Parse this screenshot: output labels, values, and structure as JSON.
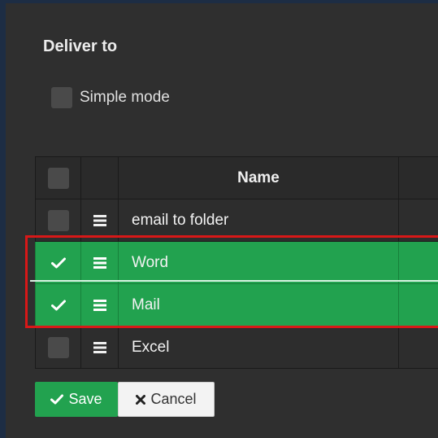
{
  "dialog": {
    "title": "Deliver to",
    "simple_mode_label": "Simple mode"
  },
  "table": {
    "header_name": "Name",
    "rows": [
      {
        "name": "email to folder",
        "checked": false
      },
      {
        "name": "Word",
        "checked": true
      },
      {
        "name": "Mail",
        "checked": true
      },
      {
        "name": "Excel",
        "checked": false
      }
    ]
  },
  "buttons": {
    "save_label": "Save",
    "cancel_label": "Cancel"
  },
  "colors": {
    "selected_row": "#22a24f",
    "highlight_border": "#d81818",
    "background": "#2f2f2f"
  },
  "icons": {
    "row_checked": "check-icon",
    "row_handle": "hamburger-icon",
    "save": "check-icon",
    "cancel": "close-icon"
  }
}
